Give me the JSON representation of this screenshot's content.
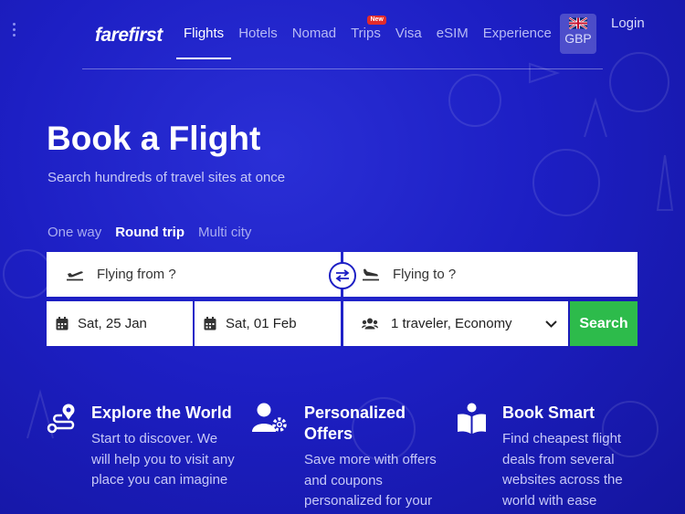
{
  "brand": {
    "logo": "farefirst"
  },
  "nav": {
    "items": [
      {
        "label": "Flights",
        "active": true
      },
      {
        "label": "Hotels"
      },
      {
        "label": "Nomad"
      },
      {
        "label": "Trips",
        "badge": "New"
      },
      {
        "label": "Visa"
      },
      {
        "label": "eSIM"
      },
      {
        "label": "Experience"
      }
    ],
    "currency": "GBP",
    "login": "Login"
  },
  "hero": {
    "title": "Book a Flight",
    "subtitle": "Search hundreds of travel sites at once"
  },
  "trip_types": {
    "one_way": "One way",
    "round_trip": "Round trip",
    "multi_city": "Multi city",
    "selected": "Round trip"
  },
  "search": {
    "from_placeholder": "Flying from ?",
    "to_placeholder": "Flying to ?",
    "depart_date": "Sat, 25 Jan",
    "return_date": "Sat, 01 Feb",
    "travelers": "1 traveler, Economy",
    "button": "Search"
  },
  "features": [
    {
      "title": "Explore the World",
      "text": "Start to discover. We will help you to visit any place you can imagine",
      "icon": "route-icon"
    },
    {
      "title": "Personalized Offers",
      "text": "Save more with offers and coupons personalized for your",
      "icon": "user-gear-icon"
    },
    {
      "title": "Book Smart",
      "text": "Find cheapest flight deals from several websites across the world with ease",
      "icon": "book-open-icon"
    }
  ],
  "colors": {
    "background": "#1d1fc4",
    "search_button": "#2dbb4b",
    "badge": "#e32b2b"
  }
}
